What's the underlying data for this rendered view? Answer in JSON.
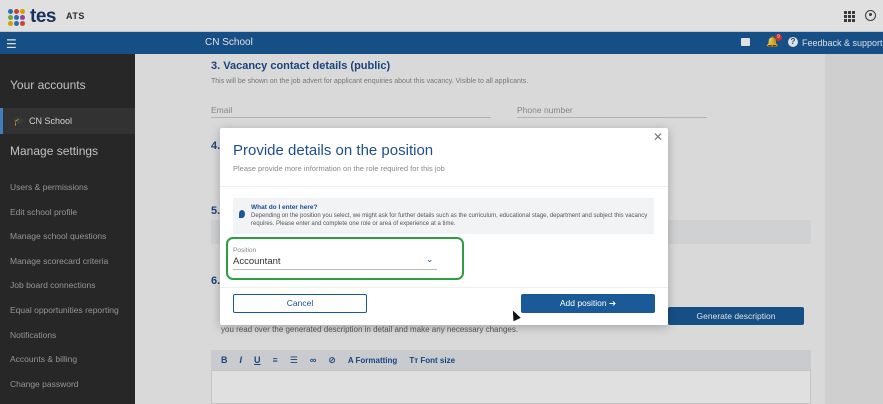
{
  "header": {
    "logo_text": "tes",
    "app_name": "ATS",
    "logo_dot_colors": [
      "#2f7fd1",
      "#e94c3d",
      "#f5b400",
      "#7cc144",
      "#2f7fd1",
      "#a44ac4",
      "#f5b400",
      "#2f7fd1",
      "#e94c3d"
    ]
  },
  "bluebar": {
    "school_name": "CN School",
    "notification_count": "9",
    "feedback_label": "Feedback & support"
  },
  "sidebar": {
    "your_accounts": "Your accounts",
    "current_account": "CN School",
    "manage_settings": "Manage settings",
    "items": [
      "Users & permissions",
      "Edit school profile",
      "Manage school questions",
      "Manage scorecard criteria",
      "Job board connections",
      "Equal opportunities reporting",
      "Notifications",
      "Accounts & billing",
      "Change password"
    ]
  },
  "page": {
    "section3_title": "3.  Vacancy contact details (public)",
    "section3_desc": "This will be shown on the job advert for applicant enquiries about this vacancy. Visible to all applicants.",
    "email_placeholder": "Email",
    "phone_placeholder": "Phone number",
    "section4_num": "4.",
    "section5_num": "5.",
    "section6_num": "6.",
    "generate_button": "Generate description",
    "hint": "you read over the generated description in detail and make any necessary changes.",
    "toolbar": {
      "bold": "B",
      "italic": "I",
      "underline": "U",
      "formatting": "Formatting",
      "font_size": "Font size"
    }
  },
  "modal": {
    "title": "Provide details on the position",
    "subtitle": "Please provide more information on the role required for this job",
    "info_title": "What do I enter here?",
    "info_text": "Depending on the position you select, we might ask for further details such as the curriculum, educational stage, department and subject this vacancy requires. Please enter and complete one role or area of experience at a time.",
    "position_label": "Position",
    "position_value": "Accountant",
    "cancel_label": "Cancel",
    "add_label": "Add position",
    "highlight_color": "#2e9e44"
  }
}
